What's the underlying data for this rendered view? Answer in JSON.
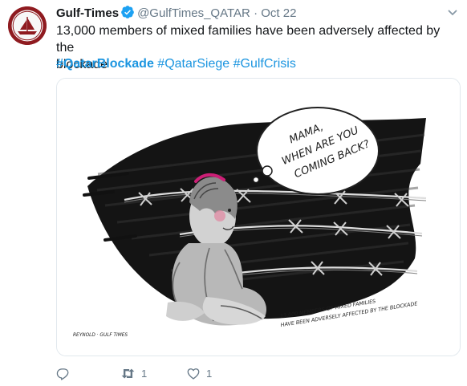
{
  "tweet": {
    "name": "Gulf-Times",
    "handle": "@GulfTimes_QATAR",
    "separator": "·",
    "time": "Oct 22",
    "text": "13,000 members of mixed families have been adversely affected by the\nblockade",
    "hashtags": [
      "#QatarBlockade",
      "#QatarSiege",
      "#GulfCrisis"
    ]
  },
  "media": {
    "thought_bubble": [
      "MAMA,",
      "WHEN ARE YOU",
      "COMING BACK?"
    ],
    "caption": [
      "13,000 MEMBERS OF MIXED FAMILIES",
      "HAVE BEEN ADVERSELY AFFECTED BY THE BLOCKADE"
    ],
    "signature": "REYNOLD · GULF TIMES"
  },
  "actions": {
    "reply_count": "",
    "retweet_count": "1",
    "like_count": "1"
  },
  "colors": {
    "name": "#14171a",
    "secondary": "#657786",
    "hashtag": "#1b95e0",
    "verified": "#1da1f2",
    "avatar": "#8f1b20",
    "border": "#e1e8ed"
  },
  "icons": {
    "verified": "verified-badge-icon",
    "menu": "chevron-down-icon",
    "reply": "reply-icon",
    "retweet": "retweet-icon",
    "like": "heart-icon"
  }
}
